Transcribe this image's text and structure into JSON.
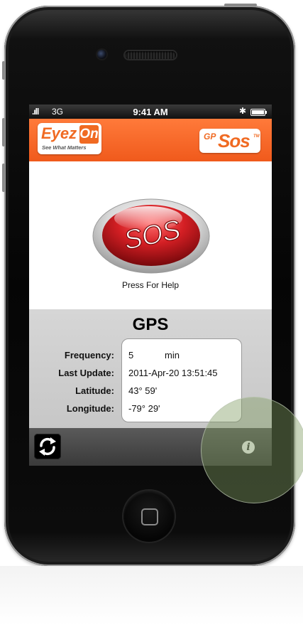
{
  "status_bar": {
    "signal": ".ıll",
    "carrier": "3G",
    "time": "9:41 AM",
    "bluetooth": "✱"
  },
  "header": {
    "left_logo": {
      "word": "Eyez",
      "badge": "On",
      "tagline": "See What Matters"
    },
    "right_logo": {
      "prefix": "GP",
      "word": "Sos",
      "mark": "TM"
    }
  },
  "sos": {
    "button_text": "SOS",
    "label": "Press For Help"
  },
  "gps": {
    "title": "GPS",
    "fields": [
      {
        "label": "Frequency:",
        "value": "5",
        "unit": "min"
      },
      {
        "label": "Last Update:",
        "value": "2011-Apr-20 13:51:45"
      },
      {
        "label": "Latitude:",
        "value": "43° 59'"
      },
      {
        "label": "Longitude:",
        "value": "-79° 29'"
      }
    ]
  },
  "toolbar": {
    "refresh_icon": "refresh-icon",
    "info_icon": "info-icon",
    "info_glyph": "i"
  },
  "colors": {
    "header_orange": "#f05a1c",
    "sos_red": "#c4161c",
    "gps_panel": "#cfcfcf",
    "toolbar": "#4a4a4a"
  }
}
